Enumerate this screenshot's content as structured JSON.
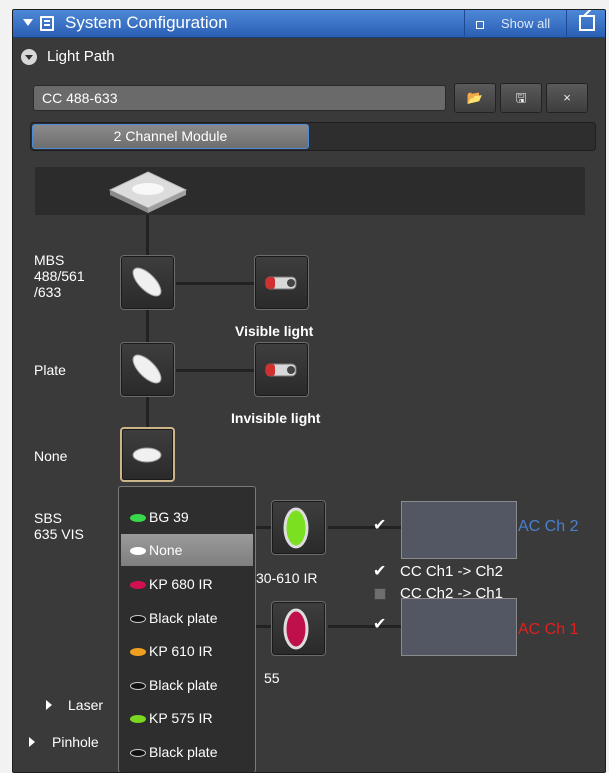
{
  "panel": {
    "title": "System Configuration",
    "show_all_label": "Show all",
    "accent": "#2a62b8"
  },
  "light_path": {
    "label": "Light Path",
    "config_name": "CC 488-633",
    "buttons": [
      {
        "icon": "folder-open-icon",
        "glyph": "📂"
      },
      {
        "icon": "save-icon",
        "glyph": "🖫"
      },
      {
        "icon": "close-icon",
        "glyph": "×"
      }
    ],
    "tabs": [
      {
        "label": "2 Channel Module",
        "active": true
      },
      {
        "label": "",
        "active": false
      }
    ],
    "components": {
      "mbs_label": "MBS\n488/561\n/633",
      "visible_light": "Visible light",
      "plate_label": "Plate",
      "invisible_light": "Invisible light",
      "none_label": "None",
      "sbs_label": "SBS\n635 VIS",
      "filter1_label": "30-610 IR",
      "filter2_label": "55"
    },
    "routing": {
      "ch1_to_ch2": {
        "label": "CC Ch1 -> Ch2",
        "checked": true
      },
      "ch2_to_ch1": {
        "label": "CC Ch2 -> Ch1",
        "checked": false
      },
      "ch2_checked": true,
      "ch1_checked": true,
      "channel2_label": "AC Ch 2",
      "channel1_label": "AC Ch 1",
      "channel2_color": "#4a7fd0",
      "channel1_color": "#e02020"
    },
    "dropdown": {
      "selected": "None",
      "items": [
        {
          "label": "BG 39",
          "color": "#39d84a"
        },
        {
          "label": "None",
          "color": "#ffffff"
        },
        {
          "label": "KP 680 IR",
          "color": "#d01050"
        },
        {
          "label": "Black plate",
          "color": "#111111"
        },
        {
          "label": "KP 610 IR",
          "color": "#f0a020"
        },
        {
          "label": "Black plate",
          "color": "#111111"
        },
        {
          "label": "KP 575 IR",
          "color": "#7ad820"
        },
        {
          "label": "Black plate",
          "color": "#111111"
        }
      ]
    }
  },
  "tree": {
    "laser_label": "Laser",
    "pinhole_label": "Pinhole"
  }
}
